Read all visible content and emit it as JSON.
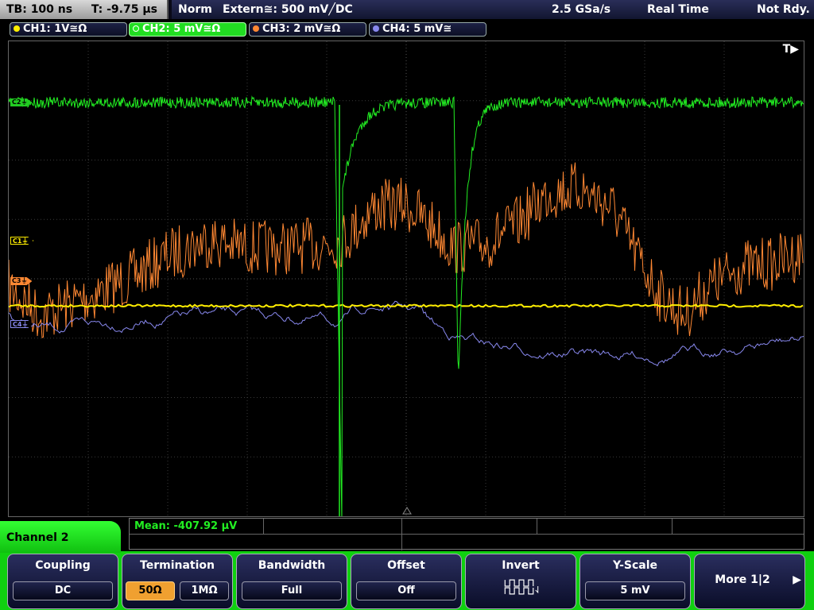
{
  "header": {
    "timebase": "TB: 100 ns",
    "trigger_time": "T: -9.75 µs",
    "mode": "Norm",
    "trigger_source": "Extern≅: 500 mV",
    "trigger_slope": "╱DC",
    "sample_rate": "2.5 GSa/s",
    "acq_mode": "Real Time",
    "status": "Not Rdy."
  },
  "channels": [
    {
      "label": "CH1: 1V≅Ω",
      "color": "#ffee00",
      "marker": "C1"
    },
    {
      "label": "CH2: 5 mV≅Ω",
      "color": "#22ee22",
      "marker": "C2"
    },
    {
      "label": "CH3: 2 mV≅Ω",
      "color": "#ff8833",
      "marker": "C3"
    },
    {
      "label": "CH4: 5 mV≅",
      "color": "#8888ee",
      "marker": "C4"
    }
  ],
  "screen": {
    "trigger_marker": "T▶"
  },
  "measurement": {
    "text": "Mean: -407.92 µV"
  },
  "menu": {
    "title": "Channel 2",
    "coupling": {
      "label": "Coupling",
      "value": "DC"
    },
    "termination": {
      "label": "Termination",
      "options": [
        "50Ω",
        "1MΩ"
      ],
      "selected": "50Ω"
    },
    "bandwidth": {
      "label": "Bandwidth",
      "value": "Full"
    },
    "offset": {
      "label": "Offset",
      "value": "Off"
    },
    "invert": {
      "label": "Invert",
      "icon": "inverted-square-wave-icon"
    },
    "yscale": {
      "label": "Y-Scale",
      "value": "5 mV"
    },
    "more": {
      "label": "More 1|2"
    }
  }
}
